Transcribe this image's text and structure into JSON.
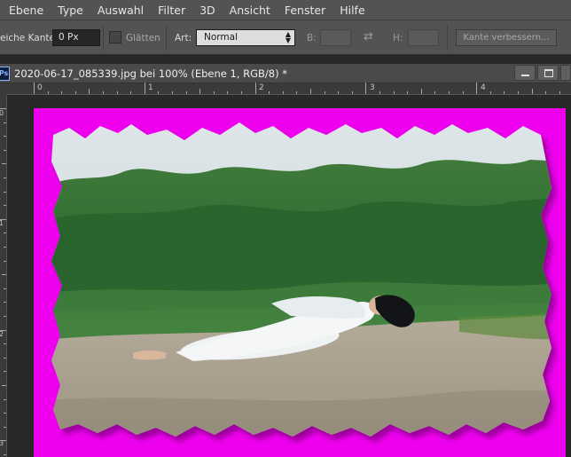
{
  "menu": {
    "items": [
      "Ebene",
      "Type",
      "Auswahl",
      "Filter",
      "3D",
      "Ansicht",
      "Fenster",
      "Hilfe"
    ]
  },
  "options": {
    "feather_label": "eiche Kante:",
    "feather_value": "0 Px",
    "smooth_label": "Glätten",
    "style_label": "Art:",
    "style_value": "Normal",
    "width_label": "B:",
    "height_label": "H:",
    "refine_button": "Kante verbessern..."
  },
  "document": {
    "app_badge": "Ps",
    "tab_title": "2020-06-17_085339.jpg bei 100% (Ebene 1, RGB/8) *"
  },
  "rulers": {
    "h_labels": [
      "0",
      "1",
      "2",
      "3",
      "4"
    ],
    "v_labels": [
      "0",
      "1",
      "2",
      "3"
    ]
  },
  "colors": {
    "background_fill": "#ee00ee",
    "panel": "#535353"
  },
  "icons": {
    "swap": "swap-arrows-icon",
    "minimize": "minimize-icon",
    "maximize": "maximize-icon",
    "dropdown": "chevron-updown-icon"
  }
}
